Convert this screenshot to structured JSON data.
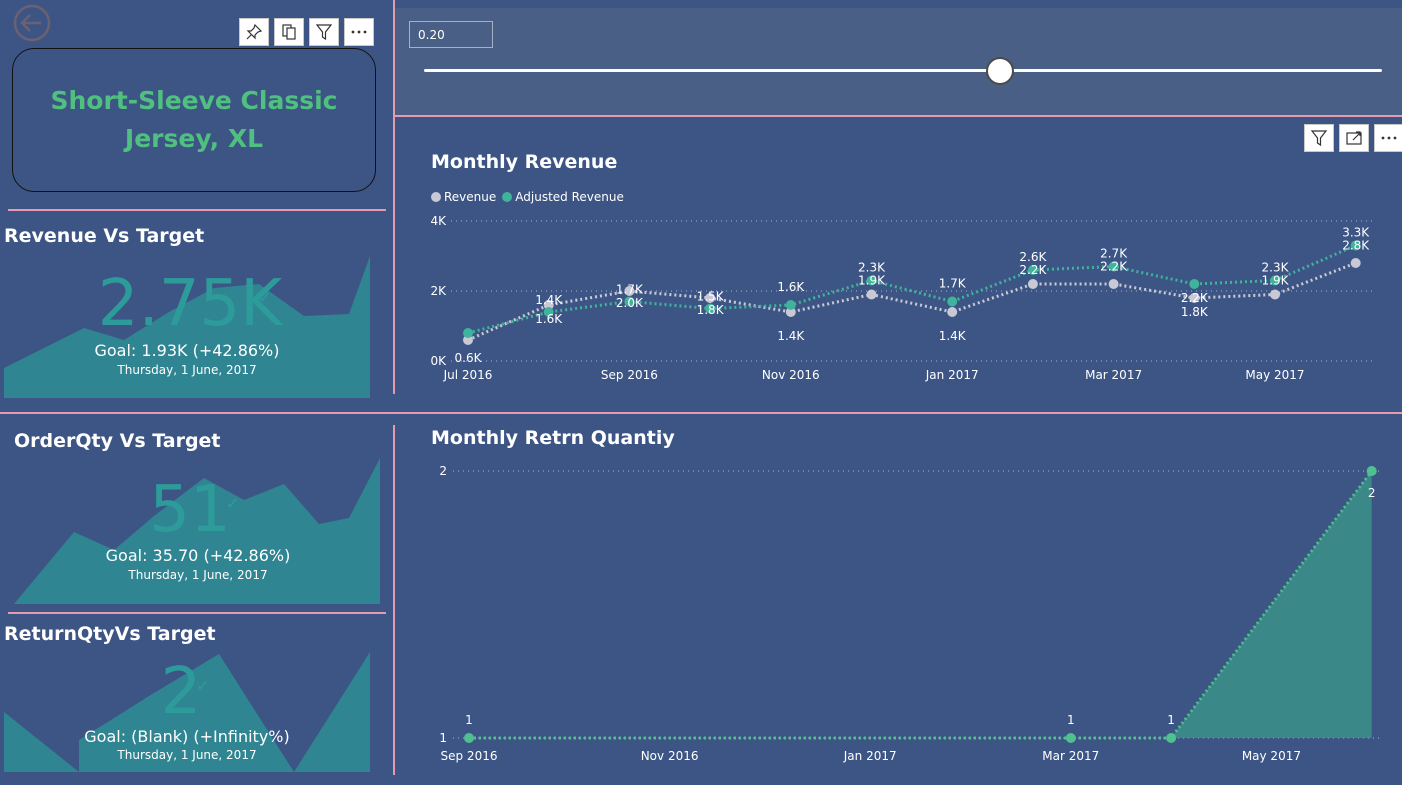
{
  "product_card": {
    "title_line1": "Short-Sleeve Classic",
    "title_line2": "Jersey, XL"
  },
  "slicer": {
    "value": "0.20",
    "fraction": 0.605
  },
  "kpis": [
    {
      "title": "Revenue Vs Target",
      "value": "2.75K",
      "goal": "Goal: 1.93K (+42.86%)",
      "date": "Thursday, 1 June, 2017"
    },
    {
      "title": "OrderQty Vs Target",
      "value": "51",
      "goal": "Goal: 35.70 (+42.86%)",
      "date": "Thursday, 1 June, 2017"
    },
    {
      "title": "ReturnQtyVs Target",
      "value": "2",
      "goal": "Goal: (Blank) (+Infinity%)",
      "date": "Thursday, 1 June, 2017"
    }
  ],
  "colors": {
    "background": "#3d5585",
    "divider": "#e59ab0",
    "teal": "#2e9b9b",
    "kpi_area": "#2e8b92",
    "revenue": "#c9c9d6",
    "adjusted": "#3fb39b",
    "title_green": "#4fc07f"
  },
  "icons": [
    "back-arrow-icon",
    "pin-icon",
    "copy-icon",
    "filter-icon",
    "more-icon",
    "focus-mode-icon"
  ],
  "chart_data": [
    {
      "type": "line",
      "title": "Monthly Revenue",
      "legend_position": "top-left",
      "x_tick_labels": [
        "Jul 2016",
        "Sep 2016",
        "Nov 2016",
        "Jan 2017",
        "Mar 2017",
        "May 2017"
      ],
      "y_tick_labels": [
        "0K",
        "2K",
        "4K"
      ],
      "ylim": [
        0,
        4000
      ],
      "grid": true,
      "categories": [
        "Jul 2016",
        "Aug 2016",
        "Sep 2016",
        "Oct 2016",
        "Nov 2016",
        "Dec 2016",
        "Jan 2017",
        "Feb 2017",
        "Mar 2017",
        "Apr 2017",
        "May 2017",
        "Jun 2017"
      ],
      "series": [
        {
          "name": "Revenue",
          "color": "#c9c9d6",
          "values": [
            600,
            1600,
            2000,
            1800,
            1400,
            1900,
            1400,
            2200,
            2200,
            1800,
            1900,
            2800
          ],
          "labels": [
            "0.6K",
            "1.6K",
            "2.0K",
            "1.8K",
            "1.4K",
            "1.9K",
            "1.4K",
            "2.2K",
            "2.2K",
            "1.8K",
            "1.9K",
            "2.8K"
          ]
        },
        {
          "name": "Adjusted Revenue",
          "color": "#3fb39b",
          "values": [
            800,
            1400,
            1700,
            1500,
            1600,
            2300,
            1700,
            2600,
            2700,
            2200,
            2300,
            3300
          ],
          "labels": [
            "",
            "1.4K",
            "1.7K",
            "1.5K",
            "1.6K",
            "2.3K",
            "1.7K",
            "2.6K",
            "2.7K",
            "2.2K",
            "2.3K",
            "3.3K"
          ]
        }
      ]
    },
    {
      "type": "area",
      "title": "Monthly Retrn Quantiy",
      "x_tick_labels": [
        "Sep 2016",
        "Nov 2016",
        "Jan 2017",
        "Mar 2017",
        "May 2017"
      ],
      "y_tick_labels": [
        "1",
        "2"
      ],
      "ylim": [
        1,
        2
      ],
      "grid": true,
      "categories": [
        "Sep 2016",
        "Mar 2017",
        "Apr 2017",
        "Jun 2017"
      ],
      "values": [
        1,
        1,
        1,
        2
      ],
      "labels": [
        "1",
        "1",
        "1",
        "2"
      ]
    }
  ]
}
